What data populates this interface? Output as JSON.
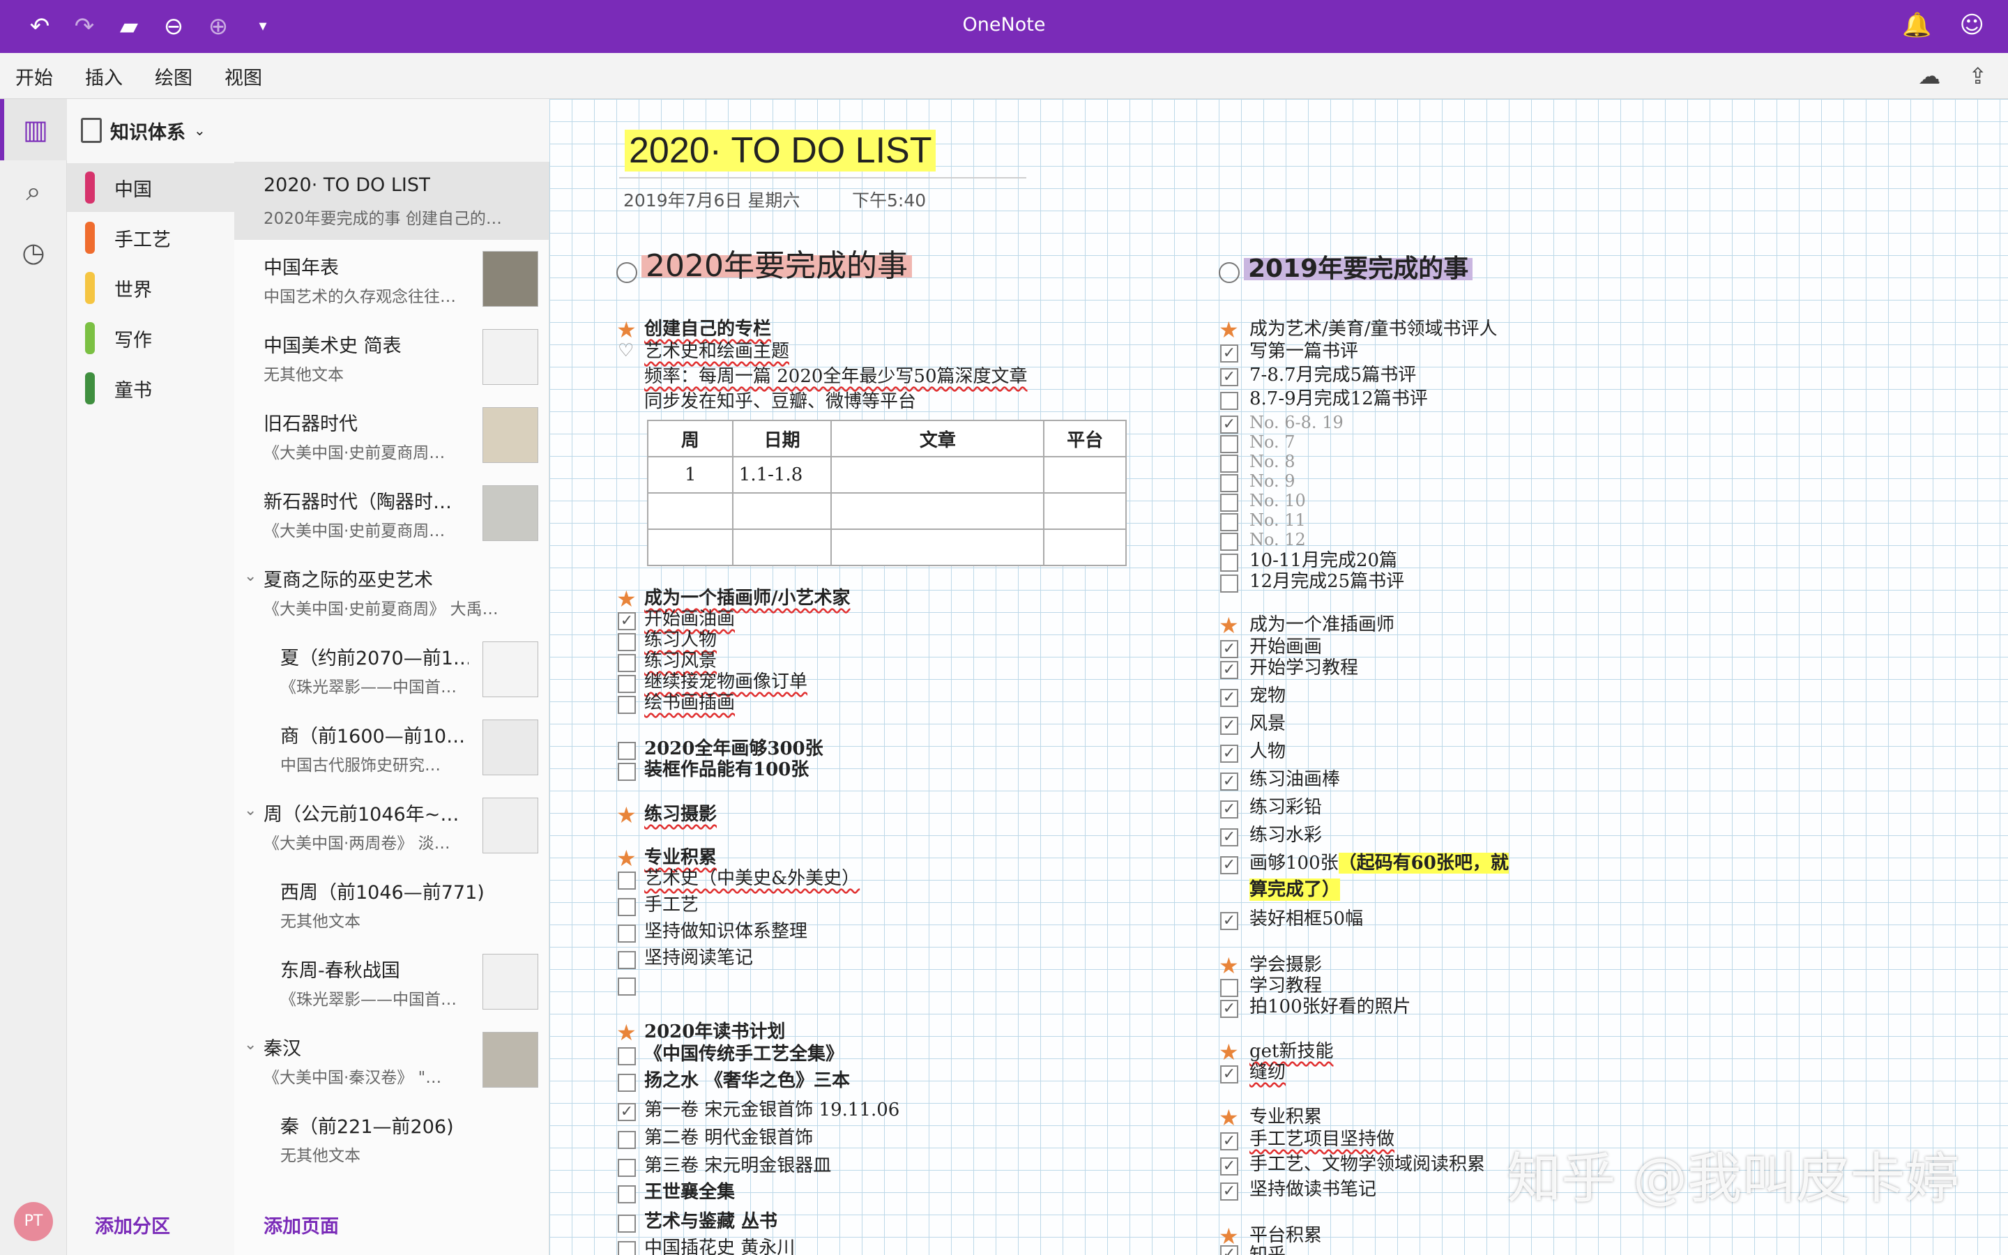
{
  "app": {
    "title": "OneNote"
  },
  "titlebar": {
    "icons": [
      "undo-icon",
      "redo-icon",
      "open-folder-icon",
      "back-icon",
      "forward-icon",
      "more-icon"
    ],
    "right_icons": [
      "bell-icon",
      "smiley-icon"
    ]
  },
  "menu": {
    "items": [
      "开始",
      "插入",
      "绘图",
      "视图"
    ]
  },
  "notebook": {
    "name": "知识体系"
  },
  "sections": [
    {
      "label": "中国",
      "color": "#d6336c"
    },
    {
      "label": "手工艺",
      "color": "#ef6c2e"
    },
    {
      "label": "世界",
      "color": "#f5c542"
    },
    {
      "label": "写作",
      "color": "#7bc043"
    },
    {
      "label": "童书",
      "color": "#3f8f3f"
    }
  ],
  "add_section": "添加分区",
  "add_page": "添加页面",
  "avatar": "PT",
  "pages": [
    {
      "title": "2020· TO DO LIST",
      "sub": "2020年要完成的事  创建自己的…"
    },
    {
      "title": "中国年表",
      "sub": "中国艺术的久存观念往往…"
    },
    {
      "title": "中国美术史 简表",
      "sub": "无其他文本"
    },
    {
      "title": "旧石器时代",
      "sub": "《大美中国·史前夏商周…"
    },
    {
      "title": "新石器时代（陶器时…",
      "sub": "《大美中国·史前夏商周…"
    },
    {
      "title": "夏商之际的巫史艺术",
      "sub": "《大美中国·史前夏商周》  大禹…"
    },
    {
      "title": "夏（约前2070—前1…",
      "sub": "《珠光翠影——中国首…"
    },
    {
      "title": "商（前1600—前10…",
      "sub": "中国古代服饰史研究…"
    },
    {
      "title": "周（公元前1046年~…",
      "sub": "《大美中国·两周卷》  淡…"
    },
    {
      "title": "西周（前1046—前771)",
      "sub": "无其他文本"
    },
    {
      "title": "东周-春秋战国",
      "sub": "《珠光翠影——中国首…"
    },
    {
      "title": "秦汉",
      "sub": "《大美中国·秦汉卷》  \"…"
    },
    {
      "title": "秦（前221—前206)",
      "sub": "无其他文本"
    }
  ],
  "note": {
    "title": "2020· TO DO LIST",
    "date": "2019年7月6日 星期六",
    "time": "下午5:40",
    "left": {
      "heading": "2020年要完成的事",
      "g1_title": "创建自己的专栏",
      "g1_lines": [
        "艺术史和绘画主题",
        "频率：每周一篇 2020全年最少写50篇深度文章",
        "同步发在知乎、豆瓣、微博等平台"
      ],
      "table_headers": [
        "周",
        "日期",
        "文章",
        "平台"
      ],
      "table_row1": [
        "1",
        "1.1-1.8",
        "",
        ""
      ],
      "g2_title": "成为一个插画师/小艺术家",
      "g2_items": [
        "开始画油画",
        "练习人物",
        "练习风景",
        "继续接宠物画像订单",
        "绘书画插画"
      ],
      "g3_items": [
        "2020全年画够300张",
        "装框作品能有100张"
      ],
      "g4_title": "练习摄影",
      "g5_title": "专业积累",
      "g5_items": [
        "艺术史（中美史&外美史）",
        "手工艺",
        "坚持做知识体系整理",
        "坚持阅读笔记",
        ""
      ],
      "g6_title": "2020年读书计划",
      "g6_items": [
        "《中国传统手工艺全集》",
        "扬之水 《奢华之色》三本",
        "第一卷 宋元金银首饰 19.11.06",
        "第二卷 明代金银首饰",
        "第三卷 宋元明金银器皿",
        "王世襄全集",
        "艺术与鉴藏 丛书",
        "中国插花史 黄永川"
      ]
    },
    "right": {
      "heading": "2019年要完成的事",
      "r1_title": "成为艺术/美育/童书领域书评人",
      "r1_items": [
        "写第一篇书评",
        "7-8.7月完成5篇书评",
        "8.7-9月完成12篇书评",
        "No. 6-8. 19",
        "No. 7",
        "No. 8",
        "No. 9",
        "No. 10",
        "No. 11",
        "No. 12",
        "10-11月完成20篇",
        "12月完成25篇书评"
      ],
      "r2_title": "成为一个准插画师",
      "r2_items": [
        "开始画画",
        "开始学习教程",
        "宠物",
        "风景",
        "人物",
        "练习油画棒",
        "练习彩铅",
        "练习水彩"
      ],
      "r2_hl_pre": "画够100张",
      "r2_hl_a": "（起码有60张吧，就",
      "r2_hl_b": "算完成了）",
      "r2_last": "装好相框50幅",
      "r3_title": "学会摄影",
      "r3_items": [
        "学习教程",
        "拍100张好看的照片"
      ],
      "r4_title": "get新技能",
      "r4_items": [
        "缝纫"
      ],
      "r5_title": "专业积累",
      "r5_items": [
        "手工艺项目坚持做",
        "手工艺、文物学领域阅读积累",
        "坚持做读书笔记"
      ],
      "r6_title": "平台积累",
      "r6_items": [
        "知乎"
      ]
    }
  },
  "watermark": "知乎 @我叫皮卡婷"
}
